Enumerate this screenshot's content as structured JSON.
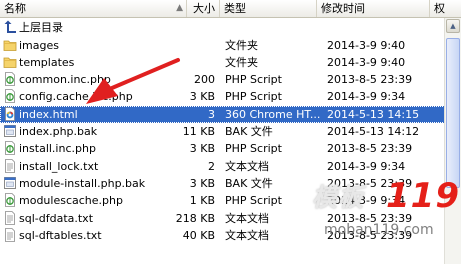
{
  "columns": {
    "name": "名称",
    "size": "大小",
    "type": "类型",
    "modified": "修改时间",
    "partial": "权"
  },
  "parent_dir": "上层目录",
  "files": [
    {
      "name": "images",
      "size": "",
      "type": "文件夹",
      "modified": "2014-3-9 9:40",
      "icon": "folder-icon"
    },
    {
      "name": "templates",
      "size": "",
      "type": "文件夹",
      "modified": "2014-3-9 9:40",
      "icon": "folder-icon"
    },
    {
      "name": "common.inc.php",
      "size": "200",
      "type": "PHP Script",
      "modified": "2013-8-5 23:39",
      "icon": "php-file-icon"
    },
    {
      "name": "config.cache.inc.php",
      "size": "3 KB",
      "type": "PHP Script",
      "modified": "2014-3-9 9:34",
      "icon": "php-file-icon"
    },
    {
      "name": "index.html",
      "size": "3",
      "type": "360 Chrome HT...",
      "modified": "2014-5-13 14:15",
      "icon": "html-file-icon",
      "selected": true
    },
    {
      "name": "index.php.bak",
      "size": "11 KB",
      "type": "BAK 文件",
      "modified": "2014-5-13 14:12",
      "icon": "bak-file-icon"
    },
    {
      "name": "install.inc.php",
      "size": "3 KB",
      "type": "PHP Script",
      "modified": "2013-8-5 23:39",
      "icon": "php-file-icon"
    },
    {
      "name": "install_lock.txt",
      "size": "2",
      "type": "文本文档",
      "modified": "2014-3-9 9:34",
      "icon": "txt-file-icon"
    },
    {
      "name": "module-install.php.bak",
      "size": "3 KB",
      "type": "BAK 文件",
      "modified": "2013-8-5 23:39",
      "icon": "bak-file-icon"
    },
    {
      "name": "modulescache.php",
      "size": "1 KB",
      "type": "PHP Script",
      "modified": "2014-3-9 9:34",
      "icon": "php-file-icon"
    },
    {
      "name": "sql-dfdata.txt",
      "size": "218 KB",
      "type": "文本文档",
      "modified": "2013-8-5 23:39",
      "icon": "txt-file-icon"
    },
    {
      "name": "sql-dftables.txt",
      "size": "40 KB",
      "type": "文本文档",
      "modified": "2013-8-5 23:39",
      "icon": "txt-file-icon"
    }
  ],
  "watermark": {
    "brand": "模板",
    "number": "119",
    "url": "moban119.com"
  },
  "colors": {
    "selection": "#3169c6",
    "arrow": "#e02020",
    "watermark_number": "#e52019"
  }
}
